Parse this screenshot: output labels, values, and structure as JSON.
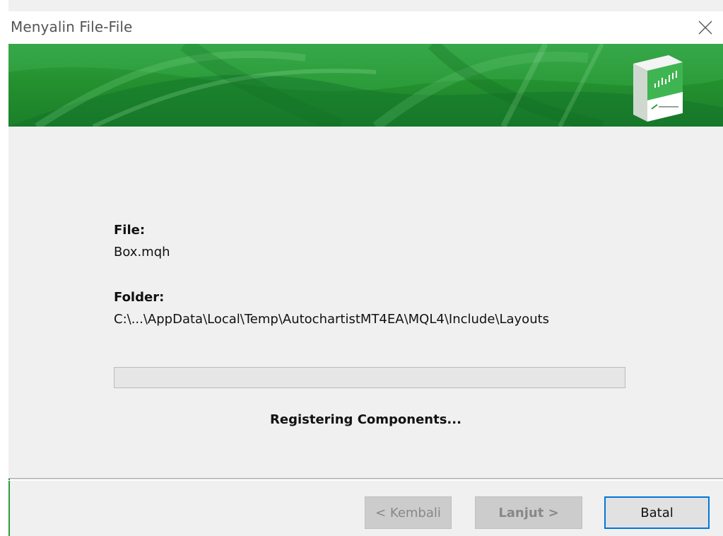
{
  "window": {
    "title": "Menyalin File-File"
  },
  "banner": {
    "brand_color": "#24912f"
  },
  "content": {
    "file_label": "File:",
    "file_value": "Box.mqh",
    "folder_label": "Folder:",
    "folder_value": "C:\\...\\AppData\\Local\\Temp\\AutochartistMT4EA\\MQL4\\Include\\Layouts",
    "progress": 0,
    "status": "Registering Components..."
  },
  "footer": {
    "back_label": "< Kembali",
    "next_label": "Lanjut >",
    "cancel_label": "Batal"
  },
  "icons": {
    "close": "close-icon",
    "product": "product-box-icon"
  },
  "colors": {
    "accent": "#0078d7",
    "banner_green": "#2e9a3b"
  }
}
